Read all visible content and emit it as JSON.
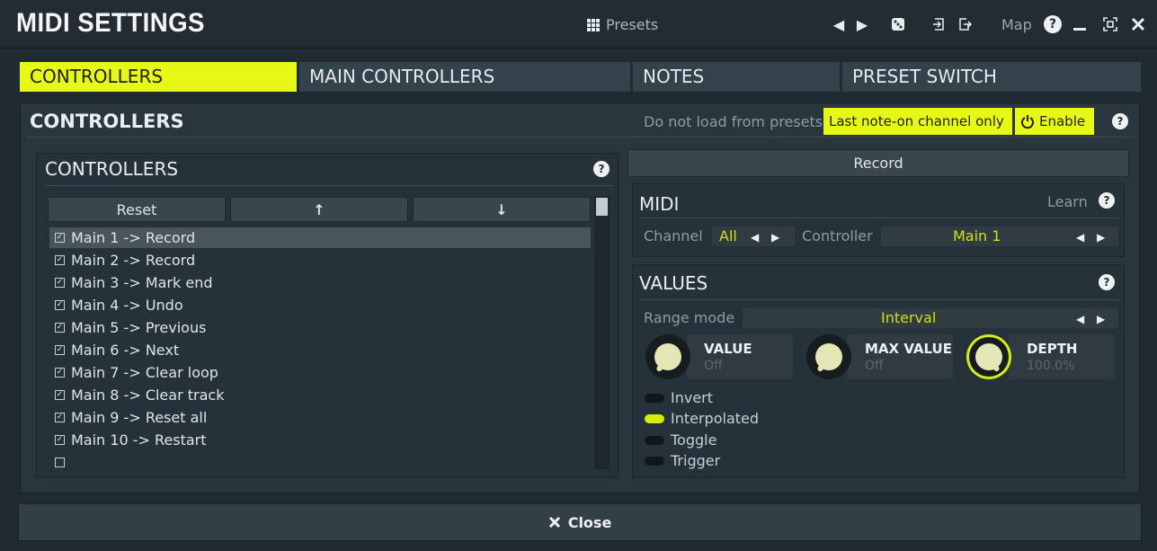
{
  "window": {
    "title": "MIDI SETTINGS",
    "presets_label": "Presets",
    "map_label": "Map"
  },
  "tabs": [
    {
      "label": "CONTROLLERS",
      "active": true
    },
    {
      "label": "MAIN CONTROLLERS",
      "active": false
    },
    {
      "label": "NOTES",
      "active": false
    },
    {
      "label": "PRESET SWITCH",
      "active": false
    }
  ],
  "controllers_panel": {
    "title": "CONTROLLERS",
    "do_not_load_label": "Do not load from presets",
    "last_note_label": "Last note-on channel only",
    "enable_label": "Enable",
    "help": "?"
  },
  "controller_list": {
    "title": "CONTROLLERS",
    "help": "?",
    "reset_label": "Reset",
    "up_label": "↑",
    "down_label": "↓",
    "items": [
      {
        "label": "Main 1 -> Record",
        "checked": true,
        "selected": true
      },
      {
        "label": "Main 2 -> Record",
        "checked": true
      },
      {
        "label": "Main 3 -> Mark end",
        "checked": true
      },
      {
        "label": "Main 4 -> Undo",
        "checked": true
      },
      {
        "label": "Main 5 -> Previous",
        "checked": true
      },
      {
        "label": "Main 6 -> Next",
        "checked": true
      },
      {
        "label": "Main 7 -> Clear loop",
        "checked": true
      },
      {
        "label": "Main 8 -> Clear track",
        "checked": true
      },
      {
        "label": "Main 9 -> Reset all",
        "checked": true
      },
      {
        "label": "Main 10 -> Restart",
        "checked": true
      },
      {
        "label": "",
        "checked": false
      }
    ]
  },
  "record_button": "Record",
  "midi": {
    "title": "MIDI",
    "learn_label": "Learn",
    "help": "?",
    "channel_label": "Channel",
    "channel_value": "All",
    "controller_label": "Controller",
    "controller_value": "Main 1"
  },
  "values": {
    "title": "VALUES",
    "help": "?",
    "range_mode_label": "Range mode",
    "range_mode_value": "Interval",
    "knobs": [
      {
        "title": "VALUE",
        "value": "Off"
      },
      {
        "title": "MAX VALUE",
        "value": "Off"
      },
      {
        "title": "DEPTH",
        "value": "100.0%"
      }
    ],
    "toggles": [
      {
        "label": "Invert",
        "on": false
      },
      {
        "label": "Interpolated",
        "on": true
      },
      {
        "label": "Toggle",
        "on": false
      },
      {
        "label": "Trigger",
        "on": false
      }
    ]
  },
  "close_label": "Close",
  "colors": {
    "accent": "#e7f816",
    "background": "#1f2a31",
    "panel": "#2a363d"
  }
}
